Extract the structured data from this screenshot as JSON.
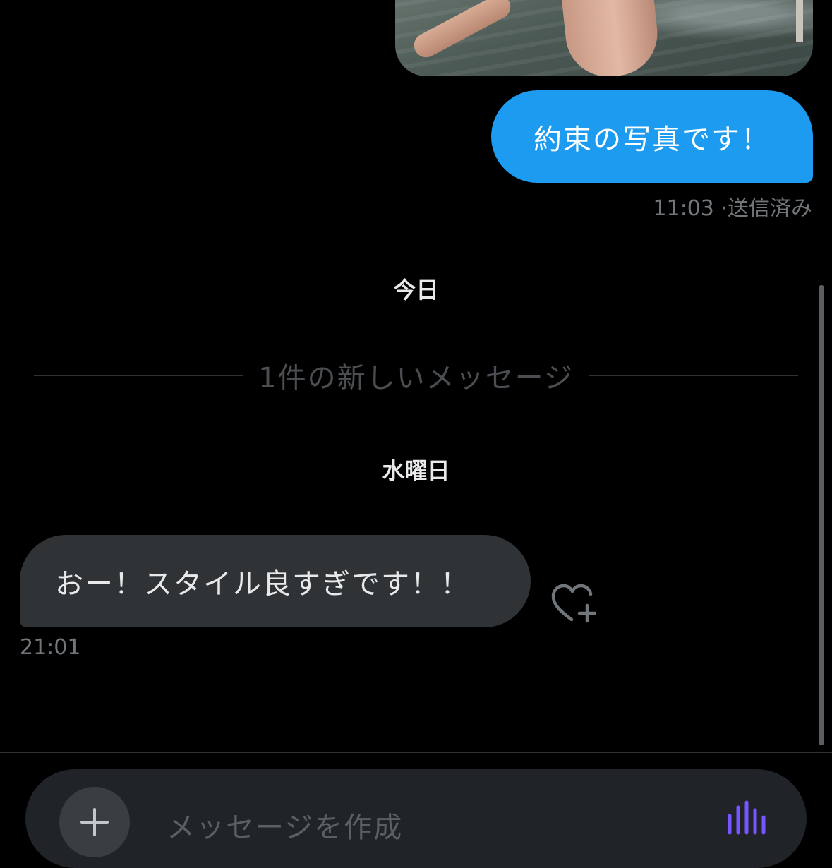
{
  "conversation": {
    "messages": [
      {
        "direction": "outgoing",
        "type": "photo",
        "image_description": "photo attachment"
      },
      {
        "direction": "outgoing",
        "text": "約束の写真です！",
        "time": "11:03",
        "status": "·送信済み"
      },
      {
        "direction": "incoming",
        "text": "おー！スタイル良すぎです！！",
        "time": "21:01"
      }
    ],
    "date_separators": {
      "today": "今日",
      "wednesday": "水曜日"
    },
    "new_messages_label": "1件の新しいメッセージ"
  },
  "composer": {
    "placeholder": "メッセージを作成",
    "add_icon": "plus-icon",
    "voice_icon": "voice-waveform-icon"
  },
  "icons": {
    "reaction": "heart-plus-icon"
  },
  "colors": {
    "background": "#000000",
    "outgoing_bubble": "#1d9bf0",
    "incoming_bubble": "#2f3336",
    "secondary_text": "#71767b",
    "voice_accent": "#7856ff"
  }
}
